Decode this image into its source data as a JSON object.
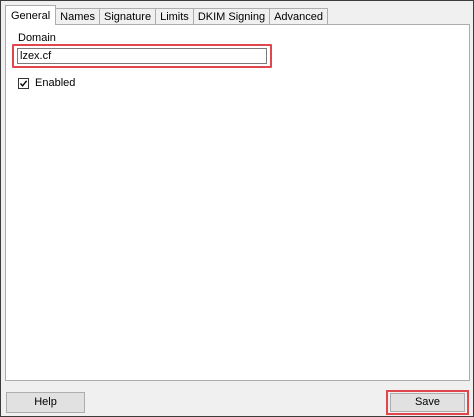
{
  "tabs": [
    {
      "label": "General",
      "active": true
    },
    {
      "label": "Names"
    },
    {
      "label": "Signature"
    },
    {
      "label": "Limits"
    },
    {
      "label": "DKIM Signing"
    },
    {
      "label": "Advanced"
    }
  ],
  "general": {
    "domain_label": "Domain",
    "domain_value": "lzex.cf",
    "enabled_label": "Enabled",
    "enabled_checked": true
  },
  "footer": {
    "help_label": "Help",
    "save_label": "Save"
  },
  "colors": {
    "highlight": "#e0474c"
  },
  "icons": {
    "enabled_checkbox": "checkmark-icon"
  }
}
